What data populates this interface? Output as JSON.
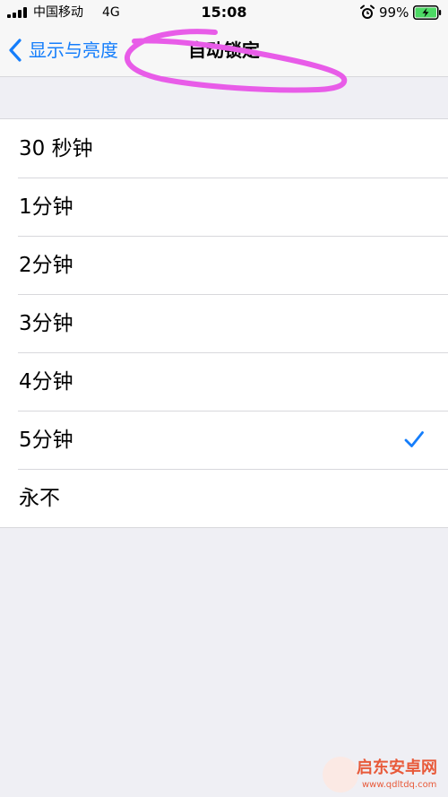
{
  "status_bar": {
    "carrier": "中国移动",
    "network": "4G",
    "time": "15:08",
    "battery": "99%",
    "signal_icon": "signal-bars-icon",
    "alarm_icon": "alarm-clock-icon",
    "battery_icon": "battery-charging-icon"
  },
  "nav": {
    "back_label": "显示与亮度",
    "back_icon": "chevron-left-icon",
    "title": "自动锁定"
  },
  "options": [
    {
      "label": "30 秒钟",
      "selected": false
    },
    {
      "label": "1分钟",
      "selected": false
    },
    {
      "label": "2分钟",
      "selected": false
    },
    {
      "label": "3分钟",
      "selected": false
    },
    {
      "label": "4分钟",
      "selected": false
    },
    {
      "label": "5分钟",
      "selected": true
    },
    {
      "label": "永不",
      "selected": false
    }
  ],
  "watermark": {
    "text": "启东安卓网",
    "url": "www.qdltdq.com"
  },
  "colors": {
    "accent": "#157efb",
    "background": "#efeff4",
    "bar_background": "#f7f7f7",
    "annotation": "#e85ce8",
    "battery_green": "#4cd964"
  }
}
